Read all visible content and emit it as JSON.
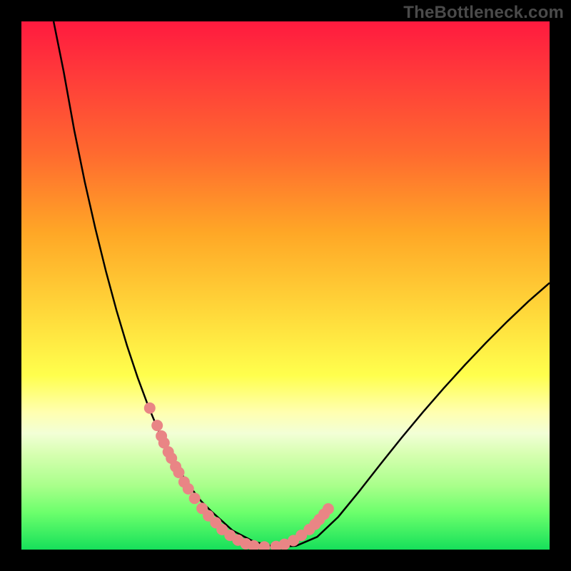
{
  "watermark": "TheBottleneck.com",
  "colors": {
    "curve_stroke": "#000000",
    "marker_fill": "#e98585",
    "background_frame": "#000000"
  },
  "chart_data": {
    "type": "line",
    "title": "",
    "xlabel": "",
    "ylabel": "",
    "xlim": [
      0,
      100
    ],
    "ylim": [
      0,
      100
    ],
    "x": [
      6.1,
      8,
      10,
      12,
      14,
      16,
      18,
      20,
      22,
      24,
      26,
      28,
      30,
      32,
      34,
      36,
      40,
      44,
      48,
      52,
      56,
      60,
      64,
      68,
      72,
      76,
      80,
      84,
      88,
      92,
      96,
      100
    ],
    "values": [
      100,
      90.5,
      79.4,
      69.6,
      60.8,
      52.7,
      45.3,
      38.6,
      32.6,
      27.2,
      22.4,
      18.3,
      14.8,
      11.8,
      9.2,
      7.2,
      3.6,
      1.5,
      0.5,
      0.7,
      2.4,
      6.2,
      11.1,
      16.2,
      21.2,
      26.0,
      30.6,
      35.0,
      39.2,
      43.2,
      47.0,
      50.5
    ],
    "markers": {
      "x": [
        24.3,
        25.7,
        26.5,
        27.0,
        27.8,
        28.4,
        29.2,
        29.8,
        30.8,
        31.6,
        32.8,
        34.2,
        35.4,
        36.8,
        38.0,
        39.5,
        41.0,
        42.5,
        44.0,
        46.0,
        48.2,
        49.8,
        51.5,
        53.0,
        54.5,
        55.6,
        56.4,
        57.3,
        58.1
      ],
      "y": [
        26.8,
        23.5,
        21.5,
        20.2,
        18.5,
        17.3,
        15.7,
        14.6,
        12.8,
        11.5,
        9.7,
        7.8,
        6.4,
        5.1,
        3.8,
        2.7,
        1.8,
        1.1,
        0.7,
        0.5,
        0.6,
        1.0,
        1.7,
        2.7,
        3.8,
        4.8,
        5.7,
        6.7,
        7.7
      ]
    }
  }
}
